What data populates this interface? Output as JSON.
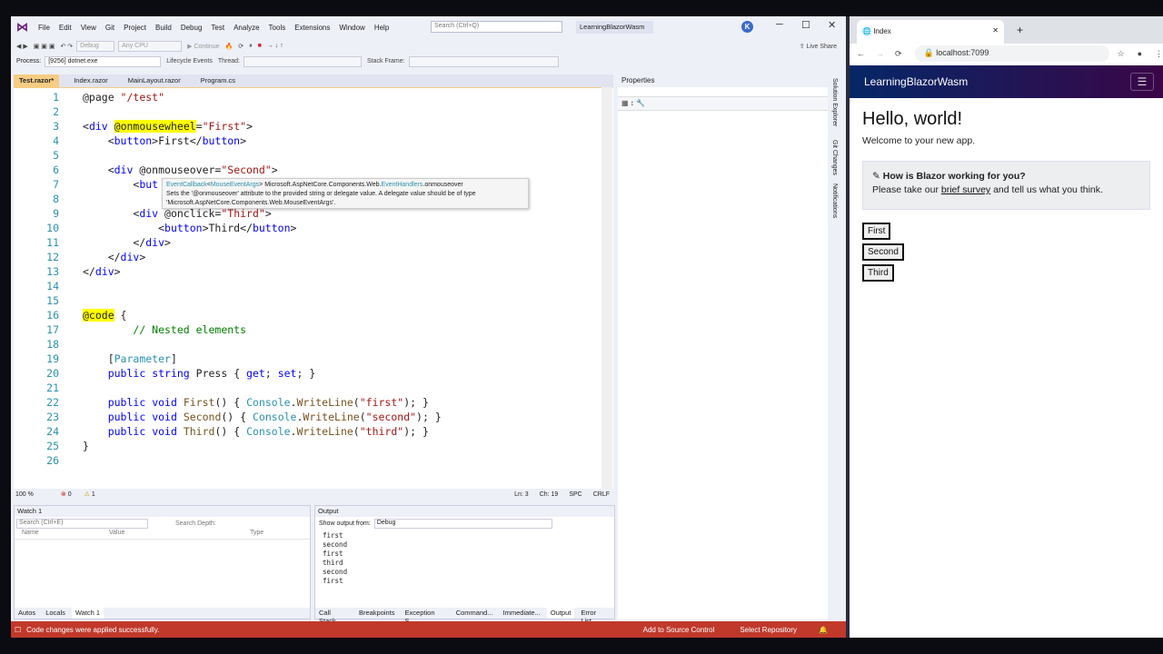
{
  "vs": {
    "menu": [
      "File",
      "Edit",
      "View",
      "Git",
      "Project",
      "Build",
      "Debug",
      "Test",
      "Analyze",
      "Tools",
      "Extensions",
      "Window",
      "Help"
    ],
    "search_placeholder": "Search (Ctrl+Q)",
    "solution_name": "LearningBlazorWasm",
    "avatar_letter": "K",
    "live_share": "Live Share",
    "debug_config": "Debug",
    "platform": "Any CPU",
    "continue": "Continue",
    "process_label": "Process:",
    "process_value": "[9256] dotnet.exe",
    "lifecycle": "Lifecycle Events",
    "thread_label": "Thread:",
    "stackframe_label": "Stack Frame:",
    "tabs": [
      "Test.razor*",
      "Index.razor",
      "MainLayout.razor",
      "Program.cs"
    ],
    "tooltip": {
      "line1_a": "EventCallback",
      "line1_b": "<",
      "line1_c": "MouseEventArgs",
      "line1_d": "> Microsoft.AspNetCore.Components.Web.",
      "line1_e": "EventHandlers",
      ".onmouseover": "",
      "line1_f": ".onmouseover",
      "line2": "Sets the '@onmouseover' attribute to the provided string or delegate value. A delegate value should be of type",
      "line3": "'Microsoft.AspNetCore.Components.Web.MouseEventArgs'."
    },
    "status": {
      "zoom": "100 %",
      "errors": "0",
      "warnings": "1",
      "ln": "Ln: 3",
      "ch": "Ch: 19",
      "spc": "SPC",
      "crlf": "CRLF"
    },
    "properties_title": "Properties",
    "side_tabs": [
      "Solution Explorer",
      "Git Changes",
      "Notifications"
    ],
    "watch": {
      "title": "Watch 1",
      "search": "Search (Ctrl+E)",
      "depth": "Search Depth:",
      "cols": [
        "Name",
        "Value",
        "Type"
      ],
      "tabs": [
        "Autos",
        "Locals",
        "Watch 1"
      ]
    },
    "output": {
      "title": "Output",
      "show_from": "Show output from:",
      "source": "Debug",
      "lines": [
        "first",
        "second",
        "first",
        "third",
        "second",
        "first"
      ],
      "tabs": [
        "Call Stack",
        "Breakpoints",
        "Exception S...",
        "Command...",
        "Immediate...",
        "Output",
        "Error List"
      ]
    },
    "statusbar": {
      "message": "Code changes were applied successfully.",
      "source_control": "Add to Source Control",
      "repo": "Select Repository"
    }
  },
  "browser": {
    "tab_title": "Index",
    "url": "localhost:7099",
    "app_name": "LearningBlazorWasm",
    "heading": "Hello, world!",
    "welcome": "Welcome to your new app.",
    "survey_title": "How is Blazor working for you?",
    "survey_pre": "Please take our ",
    "survey_link": "brief survey",
    "survey_post": " and tell us what you think.",
    "buttons": [
      "First",
      "Second",
      "Third"
    ]
  }
}
